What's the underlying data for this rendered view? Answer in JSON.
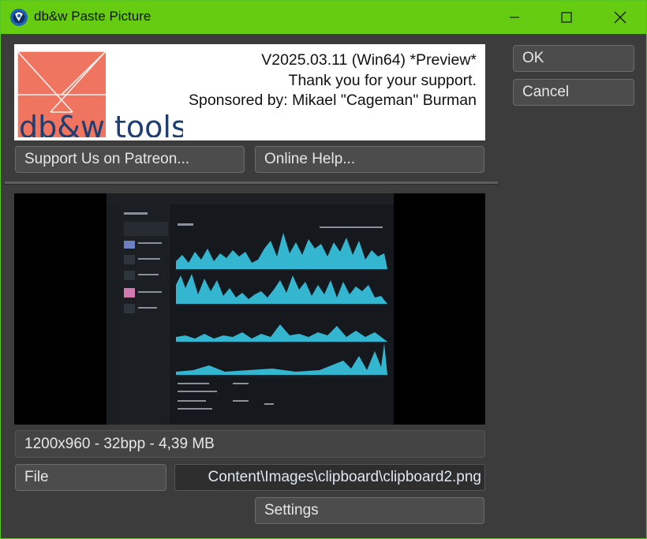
{
  "window": {
    "title": "db&w Paste Picture",
    "accent_color": "#66cc11",
    "controls": [
      "minimize-icon",
      "maximize-icon",
      "close-icon"
    ]
  },
  "banner": {
    "logo_text": "db&w tools",
    "version": "V2025.03.11 (Win64) *Preview*",
    "thanks": "Thank you for your support.",
    "sponsor": "Sponsored by: Mikael \"Cageman\" Burman"
  },
  "buttons": {
    "patreon": "Support Us on Patreon...",
    "help": "Online Help...",
    "ok": "OK",
    "cancel": "Cancel",
    "file": "File",
    "settings": "Settings"
  },
  "image_info": "1200x960 - 32bpp - 4,39 MB",
  "file_path": "Content\\Images\\clipboard\\clipboard2.png"
}
